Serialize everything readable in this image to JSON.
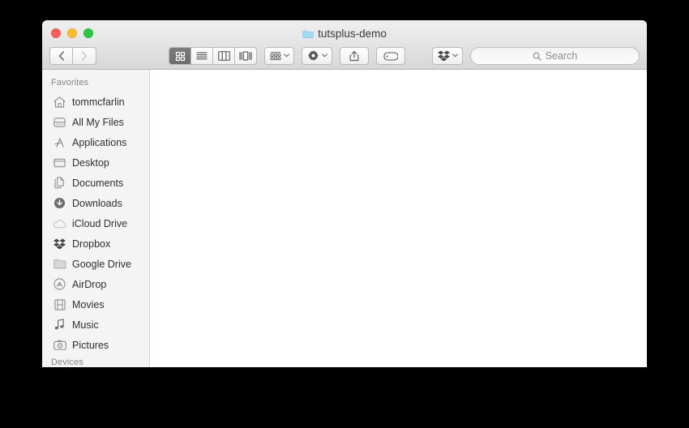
{
  "window": {
    "title": "tutsplus-demo",
    "title_icon": "folder-icon",
    "folder_icon_color": "#9fdcf4",
    "traffic_lights": [
      {
        "name": "close",
        "color": "#ff5f57"
      },
      {
        "name": "minimize",
        "color": "#ffbd2e"
      },
      {
        "name": "maximize",
        "color": "#28c940"
      }
    ]
  },
  "toolbar": {
    "back_label": "‹",
    "forward_label": "›",
    "back_icon": "chevron-left-icon",
    "forward_icon": "chevron-right-icon",
    "view_modes": [
      {
        "icon": "icon-view-icon",
        "label": "Icon View",
        "active": true
      },
      {
        "icon": "list-view-icon",
        "label": "List View",
        "active": false
      },
      {
        "icon": "column-view-icon",
        "label": "Column View",
        "active": false
      },
      {
        "icon": "gallery-view-icon",
        "label": "Gallery View",
        "active": false
      }
    ],
    "arrange_icon": "arrange-grid-icon",
    "arrange_label": "Arrange By",
    "action_icon": "gear-icon",
    "action_label": "Action",
    "share_icon": "share-icon",
    "share_label": "Share",
    "tag_icon": "tag-icon",
    "tag_label": "Edit Tags",
    "dropbox_icon": "dropbox-icon",
    "dropbox_label": "Dropbox",
    "chevron": "⌄"
  },
  "search": {
    "icon": "search-icon",
    "placeholder": "Search",
    "value": ""
  },
  "sidebar": {
    "sections": [
      {
        "header": "Favorites",
        "items": [
          {
            "label": "tommcfarlin",
            "icon": "home-icon"
          },
          {
            "label": "All My Files",
            "icon": "all-my-files-icon"
          },
          {
            "label": "Applications",
            "icon": "applications-icon"
          },
          {
            "label": "Desktop",
            "icon": "desktop-icon"
          },
          {
            "label": "Documents",
            "icon": "documents-icon"
          },
          {
            "label": "Downloads",
            "icon": "downloads-icon"
          },
          {
            "label": "iCloud Drive",
            "icon": "cloud-icon"
          },
          {
            "label": "Dropbox",
            "icon": "dropbox-icon"
          },
          {
            "label": "Google Drive",
            "icon": "folder-icon"
          },
          {
            "label": "AirDrop",
            "icon": "airdrop-icon"
          },
          {
            "label": "Movies",
            "icon": "movies-icon"
          },
          {
            "label": "Music",
            "icon": "music-note-icon"
          },
          {
            "label": "Pictures",
            "icon": "camera-icon"
          }
        ]
      },
      {
        "header": "Devices",
        "items": []
      }
    ]
  },
  "content": {
    "items": [],
    "empty": true
  }
}
